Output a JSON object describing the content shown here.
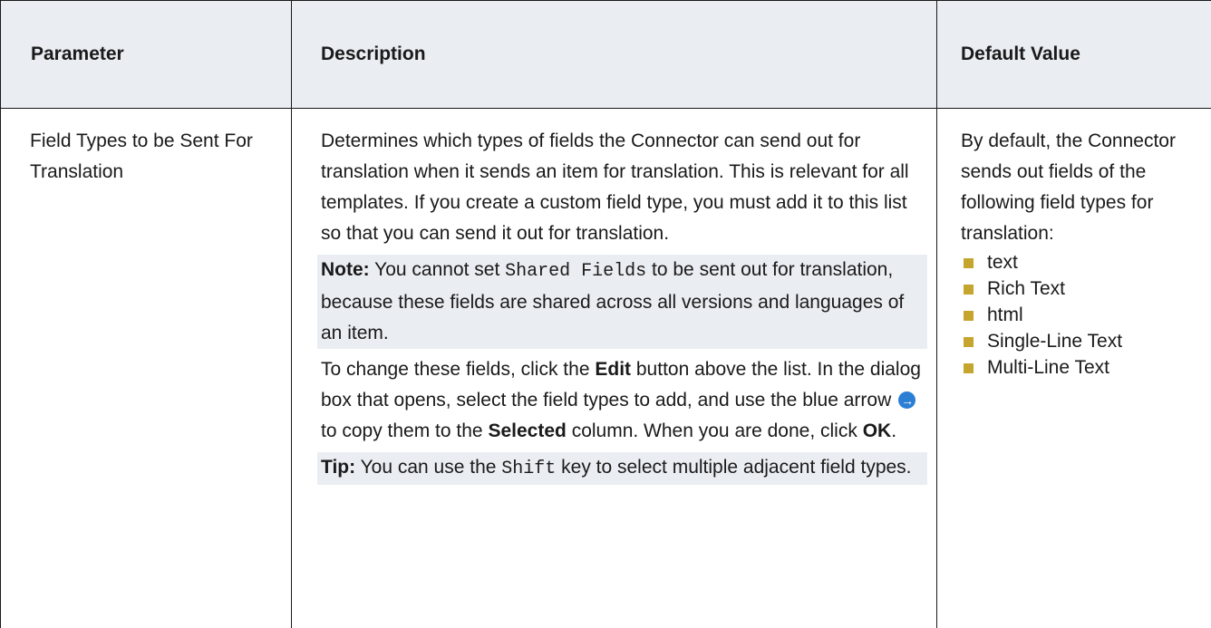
{
  "headers": {
    "parameter": "Parameter",
    "description": "Description",
    "default_value": "Default Value"
  },
  "row": {
    "parameter": "Field Types to be Sent For Translation",
    "description": {
      "intro": "Determines which types of fields the Connector can send out for translation when it sends an item for translation. This is relevant for all templates. If you create a custom field type, you must add it to this list so that you can send it out for translation.",
      "note_label": "Note:",
      "note_pre": "You cannot set",
      "note_code": "Shared Fields",
      "note_post": "to be sent out for translation, because these fields are shared across all versions and languages of an item.",
      "steps_pre": "To change these fields, click the",
      "steps_edit": "Edit",
      "steps_mid": "button above the list. In the dialog box that opens, select the field types to add, and use the blue arrow",
      "steps_mid2": "to copy them to the",
      "steps_selected": "Selected",
      "steps_post": "column. When you are done, click",
      "steps_ok": "OK",
      "steps_end": ".",
      "tip_label": "Tip:",
      "tip_pre": "You can use the",
      "tip_code": "Shift",
      "tip_post": "key to select multiple adjacent field types."
    },
    "default_value": {
      "intro": "By default, the Connector sends out fields of the following field types for translation:",
      "types": [
        "text",
        "Rich Text",
        "html",
        "Single-Line Text",
        "Multi-Line Text"
      ]
    }
  },
  "icons": {
    "blue_arrow": "arrow-right-circle-icon"
  },
  "colors": {
    "header_bg": "#eaedf1",
    "note_bg": "#eaedf1",
    "bullet": "#c6a52e",
    "arrow": "#2a7fd4"
  }
}
